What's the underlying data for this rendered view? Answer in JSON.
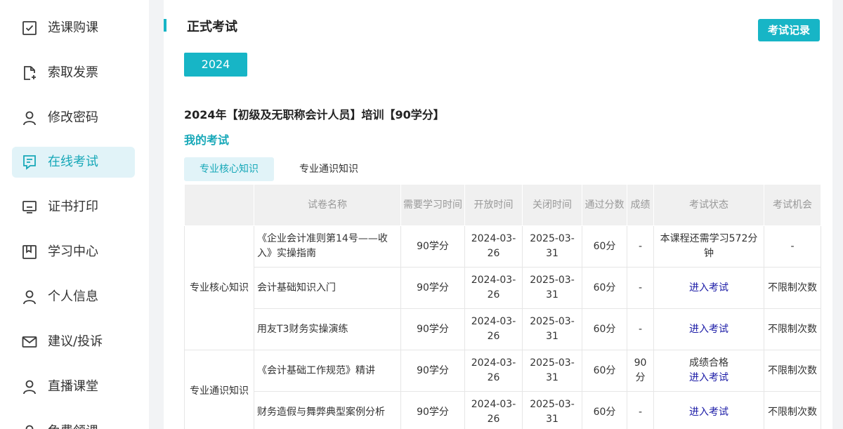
{
  "sidebar": {
    "items": [
      {
        "label": "选课购课",
        "icon": "checkbox-icon",
        "active": false
      },
      {
        "label": "索取发票",
        "icon": "invoice-add-icon",
        "active": false
      },
      {
        "label": "修改密码",
        "icon": "user-icon",
        "active": false
      },
      {
        "label": "在线考试",
        "icon": "exam-doc-icon",
        "active": true
      },
      {
        "label": "证书打印",
        "icon": "monitor-icon",
        "active": false
      },
      {
        "label": "学习中心",
        "icon": "bookmark-icon",
        "active": false
      },
      {
        "label": "个人信息",
        "icon": "user-icon",
        "active": false
      },
      {
        "label": "建议/投诉",
        "icon": "mail-icon",
        "active": false
      },
      {
        "label": "直播课堂",
        "icon": "user-icon",
        "active": false
      },
      {
        "label": "免费领课",
        "icon": "user-icon",
        "active": false
      }
    ],
    "accent_color": "#17a8b8"
  },
  "main": {
    "title": "正式考试",
    "record_button": "考试记录",
    "year_button": "2024",
    "course_title": "2024年【初级及无职称会计人员】培训【90学分】",
    "my_exam_label": "我的考试",
    "tabs": [
      {
        "label": "专业核心知识",
        "active": true
      },
      {
        "label": "专业通识知识",
        "active": false
      }
    ]
  },
  "table": {
    "headers": [
      "试卷名称",
      "需要学习时间",
      "开放时间",
      "关闭时间",
      "通过分数",
      "成绩",
      "考试状态",
      "考试机会"
    ],
    "groups": [
      "专业核心知识",
      "专业通识知识"
    ],
    "rows": [
      {
        "name": "《企业会计准则第14号——收入》实操指南",
        "study": "90学分",
        "open": "2024-03-26",
        "close": "2025-03-31",
        "pass": "60分",
        "score": "-",
        "status": "本课程还需学习572分钟",
        "status_link": "",
        "chances": "-"
      },
      {
        "name": "会计基础知识入门",
        "study": "90学分",
        "open": "2024-03-26",
        "close": "2025-03-31",
        "pass": "60分",
        "score": "-",
        "status": "",
        "status_link": "进入考试",
        "chances": "不限制次数"
      },
      {
        "name": "用友T3财务实操演练",
        "study": "90学分",
        "open": "2024-03-26",
        "close": "2025-03-31",
        "pass": "60分",
        "score": "-",
        "status": "",
        "status_link": "进入考试",
        "chances": "不限制次数"
      },
      {
        "name": "《会计基础工作规范》精讲",
        "study": "90学分",
        "open": "2024-03-26",
        "close": "2025-03-31",
        "pass": "60分",
        "score": "90分",
        "status": "成绩合格",
        "status_link": "进入考试",
        "chances": "不限制次数"
      },
      {
        "name": "财务造假与舞弊典型案例分析",
        "study": "90学分",
        "open": "2024-03-26",
        "close": "2025-03-31",
        "pass": "60分",
        "score": "-",
        "status": "",
        "status_link": "进入考试",
        "chances": "不限制次数"
      }
    ]
  }
}
